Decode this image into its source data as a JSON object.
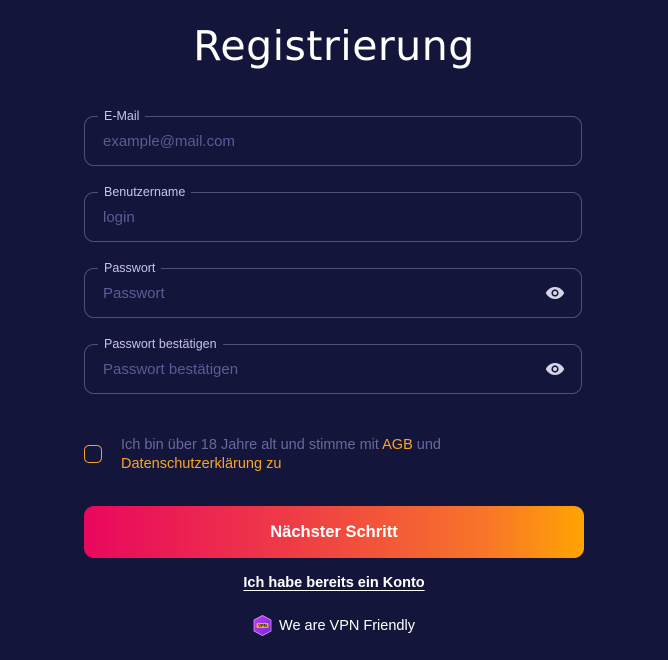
{
  "title": "Registrierung",
  "fields": [
    {
      "label": "E-Mail",
      "placeholder": "example@mail.com",
      "type": "email"
    },
    {
      "label": "Benutzername",
      "placeholder": "login",
      "type": "text"
    },
    {
      "label": "Passwort",
      "placeholder": "Passwort",
      "type": "password",
      "icon": "eye-icon"
    },
    {
      "label": "Passwort bestätigen",
      "placeholder": "Passwort bestätigen",
      "type": "password",
      "icon": "eye-icon"
    }
  ],
  "consent": {
    "text_before": "Ich bin über 18 Jahre alt und stimme mit ",
    "agb_link": "AGB",
    "text_middle": " und ",
    "privacy_link": "Datenschutzerklärung zu",
    "checked": false
  },
  "next_button": "Nächster Schritt",
  "login_link": "Ich habe bereits ein Konto",
  "vpn": {
    "badge_icon": "vpn-friendly-badge-icon",
    "badge_text": "VPN",
    "text": "We are VPN Friendly"
  },
  "colors": {
    "background": "#14153a",
    "accent_orange": "#f7a428",
    "gradient_start": "#e9075e",
    "gradient_end": "#ffa402",
    "border": "#4f4f7d",
    "placeholder": "#5d5a95"
  }
}
